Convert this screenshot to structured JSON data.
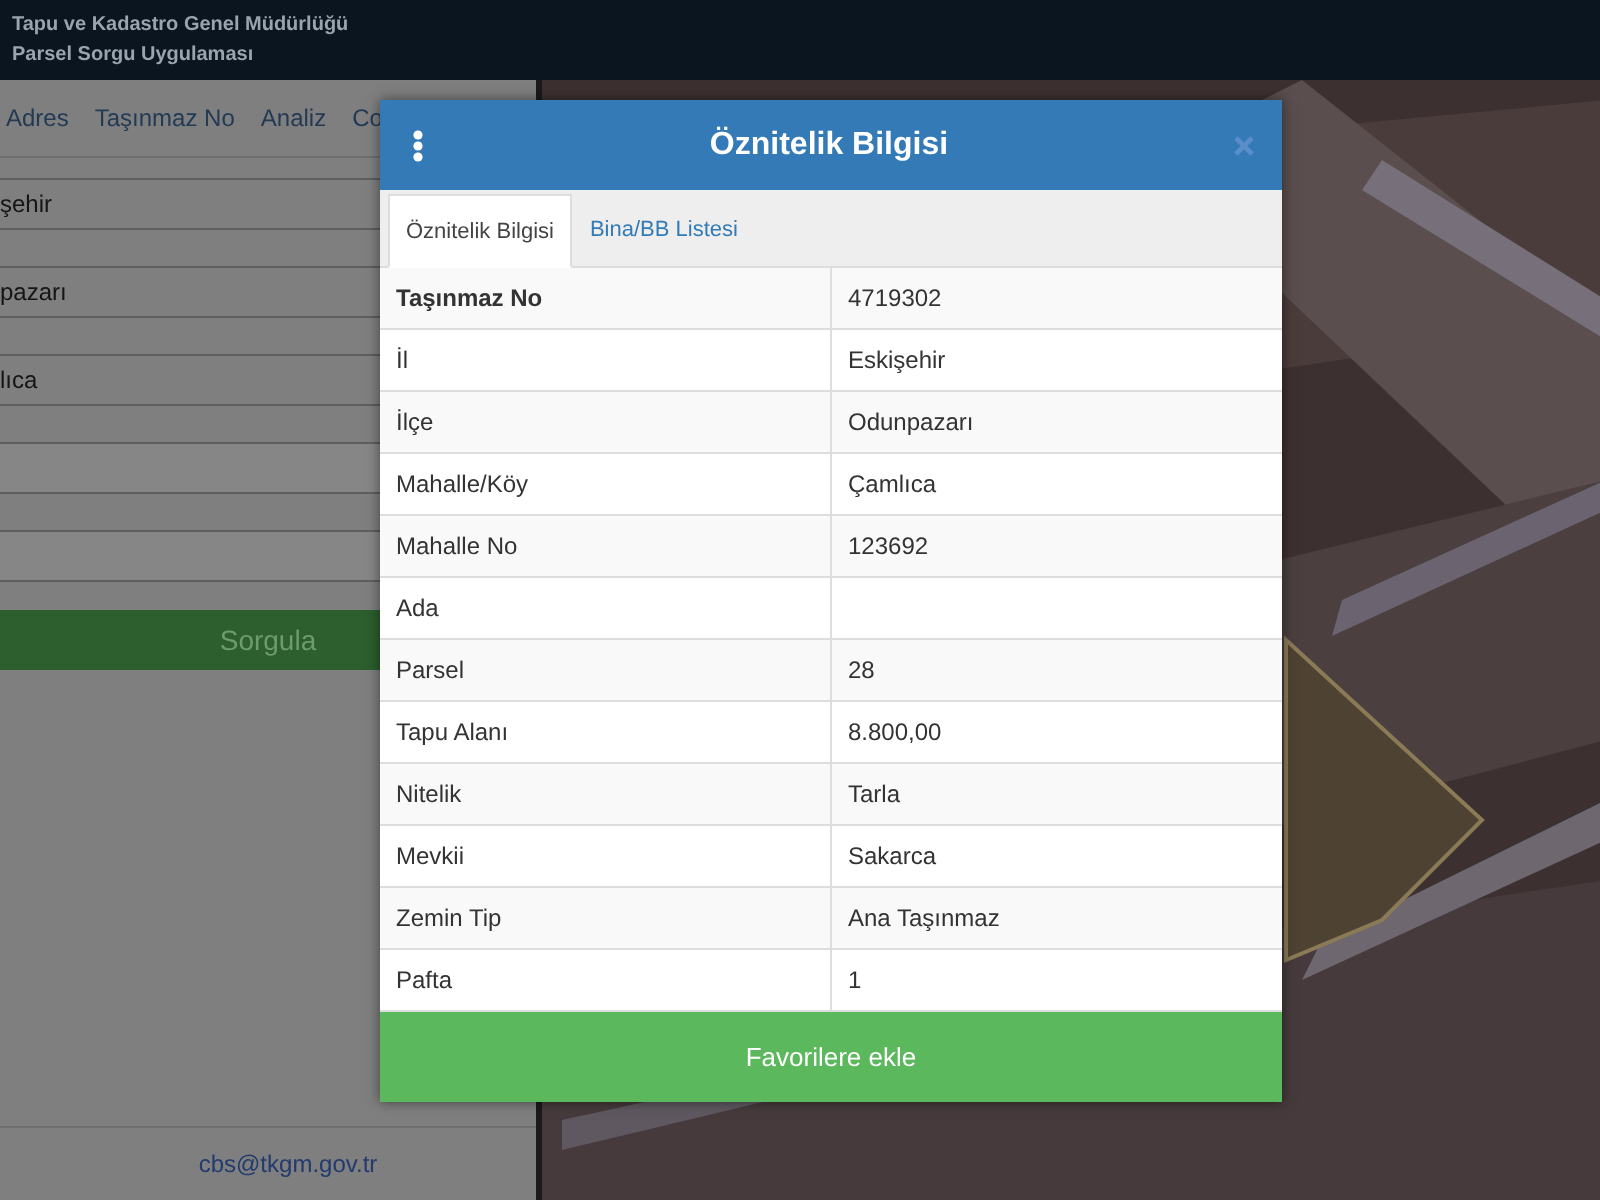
{
  "header": {
    "title": "Tapu ve Kadastro Genel Müdürlüğü",
    "subtitle": "Parsel Sorgu Uygulaması"
  },
  "side_panel": {
    "tabs": [
      {
        "label": "Adres"
      },
      {
        "label": "Taşınmaz No"
      },
      {
        "label": "Analiz"
      },
      {
        "label": "Co"
      }
    ],
    "fields": [
      {
        "kind": "text",
        "value": "şehir"
      },
      {
        "kind": "text",
        "value": "pazarı"
      },
      {
        "kind": "text",
        "value": "lıca"
      },
      {
        "kind": "blank"
      },
      {
        "kind": "blank"
      }
    ],
    "submit_button": "Sorgula",
    "contact_email": "cbs@tkgm.gov.tr"
  },
  "modal": {
    "title": "Öznitelik Bilgisi",
    "tabs": [
      {
        "label": "Öznitelik Bilgisi",
        "selected": true
      },
      {
        "label": "Bina/BB Listesi",
        "selected": false
      }
    ],
    "rows": [
      {
        "label": "Taşınmaz No",
        "value": "4719302",
        "bold": true
      },
      {
        "label": "İl",
        "value": "Eskişehir",
        "bold": false
      },
      {
        "label": "İlçe",
        "value": "Odunpazarı",
        "bold": false
      },
      {
        "label": "Mahalle/Köy",
        "value": "Çamlıca",
        "bold": false
      },
      {
        "label": "Mahalle No",
        "value": "123692",
        "bold": false
      },
      {
        "label": "Ada",
        "bold": false
      },
      {
        "label": "Parsel",
        "value": "28",
        "bold": false
      },
      {
        "label": "Tapu Alanı",
        "value": "8.800,00",
        "bold": false
      },
      {
        "label": "Nitelik",
        "value": "Tarla",
        "bold": false
      },
      {
        "label": "Mevkii",
        "value": "Sakarca",
        "bold": false
      },
      {
        "label": "Zemin Tip",
        "value": "Ana Taşınmaz",
        "bold": false
      },
      {
        "label": "Pafta",
        "value": "1",
        "bold": false
      }
    ],
    "button": "Favorilere ekle"
  }
}
